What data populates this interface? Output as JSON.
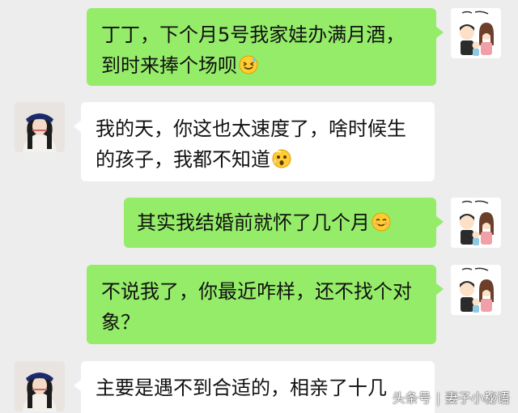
{
  "messages": [
    {
      "side": "right",
      "text": "丁丁，下个月5号我家娃办满月酒，到时来捧个场呗",
      "emoji": "grin-sweat-emoji"
    },
    {
      "side": "left",
      "text": "我的天，你这也太速度了，啥时候生的孩子，我都不知道",
      "emoji": "shocked-emoji"
    },
    {
      "side": "right",
      "text": "其实我结婚前就怀了几个月",
      "emoji": "smile-emoji"
    },
    {
      "side": "right",
      "text": "不说我了，你最近咋样，还不找个对象？",
      "emoji": ""
    },
    {
      "side": "left",
      "text": "主要是遇不到合适的，相亲了十几",
      "emoji": ""
    }
  ],
  "watermark": {
    "platform": "头条号",
    "account": "妻子小秘语"
  },
  "colors": {
    "background": "#ededed",
    "out_bubble": "#95ec69",
    "in_bubble": "#ffffff"
  }
}
